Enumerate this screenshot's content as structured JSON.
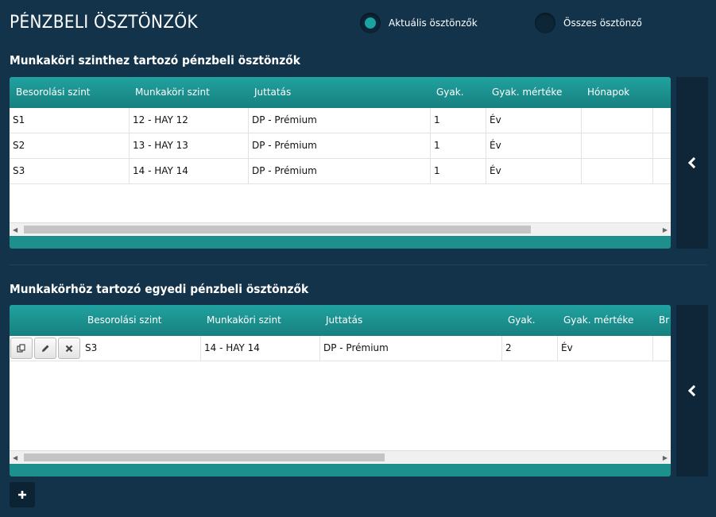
{
  "header": {
    "title": "PÉNZBELI ÖSZTÖNZŐK",
    "filter": [
      {
        "label": "Aktuális ösztönzők",
        "selected": true
      },
      {
        "label": "Összes ösztönző",
        "selected": false
      }
    ]
  },
  "section1": {
    "title": "Munkaköri szinthez tartozó pénzbeli ösztönzők",
    "columns": [
      "Besorolási szint",
      "Munkaköri szint",
      "Juttatás",
      "Gyak.",
      "Gyak. mértéke",
      "Hónapok"
    ],
    "rows": [
      [
        "S1",
        "12 - HAY 12",
        "DP - Prémium",
        "1",
        "Év",
        ""
      ],
      [
        "S2",
        "13 - HAY 13",
        "DP - Prémium",
        "1",
        "Év",
        ""
      ],
      [
        "S3",
        "14 - HAY 14",
        "DP - Prémium",
        "1",
        "Év",
        ""
      ]
    ],
    "scroll_position": 0.0
  },
  "section2": {
    "title": "Munkakörhöz tartozó egyedi pénzbeli ösztönzők",
    "columns": [
      "Besorolási szint",
      "Munkaköri szint",
      "Juttatás",
      "Gyak.",
      "Gyak. mértéke",
      "Br"
    ],
    "rows": [
      [
        "S3",
        "14 - HAY 14",
        "DP - Prémium",
        "2",
        "Év",
        ""
      ]
    ],
    "row_actions": [
      "copy-icon",
      "pencil-icon",
      "close-icon"
    ]
  },
  "icons": {
    "side_toggle": "chevron-left-icon",
    "add": "plus-icon"
  },
  "colors": {
    "background": "#13334a",
    "accent": "#1aa3a0",
    "grid_header": "#1d8f8d"
  }
}
